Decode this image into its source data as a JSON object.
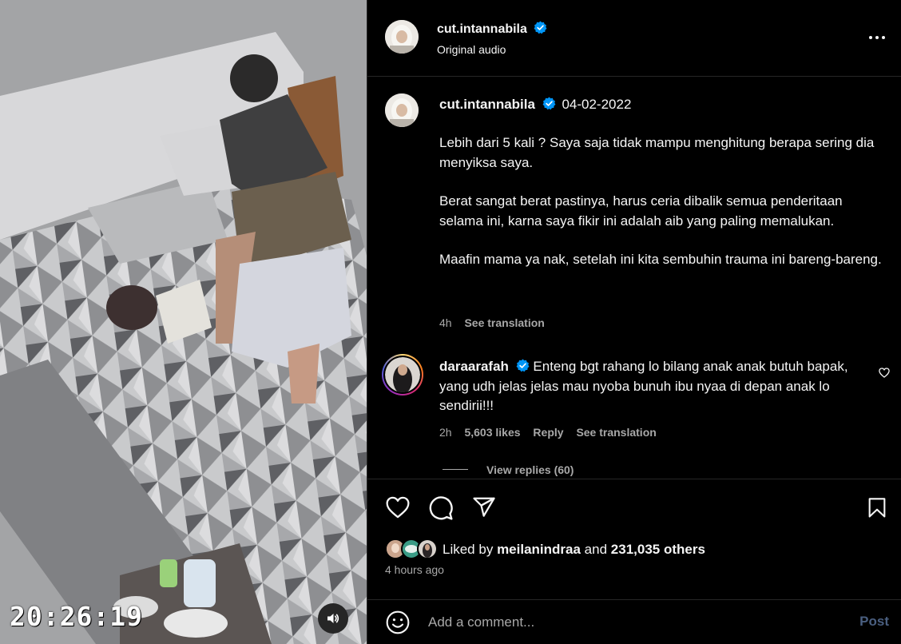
{
  "media": {
    "timestamp": "20:26:19",
    "audio_icon": "speaker-icon"
  },
  "header": {
    "username": "cut.intannabila",
    "audio_label": "Original audio",
    "more_icon": "more-horizontal-icon"
  },
  "caption": {
    "username": "cut.intannabila",
    "date": "04-02-2022",
    "paragraphs": [
      "Lebih dari 5 kali ? Saya saja tidak mampu menghitung berapa sering dia menyiksa saya.",
      "Berat sangat berat pastinya, harus ceria dibalik semua penderitaan selama ini, karna saya fikir ini adalah aib yang paling memalukan.",
      "Maafin mama ya nak, setelah ini kita sembuhin trauma ini bareng-bareng."
    ],
    "time": "4h",
    "see_translation": "See translation"
  },
  "comment": {
    "username": "daraarafah",
    "text": "Enteng bgt rahang lo bilang anak anak butuh bapak, yang udh jelas jelas mau nyoba bunuh ibu nyaa di depan anak lo sendirii!!!",
    "time": "2h",
    "likes": "5,603 likes",
    "reply": "Reply",
    "see_translation": "See translation",
    "view_replies": "View replies (60)"
  },
  "actions": {
    "liked_by_prefix": "Liked by",
    "liked_by_user": "meilanindraa",
    "and_word": "and",
    "others": "231,035 others",
    "time_ago": "4 hours ago"
  },
  "add_comment": {
    "placeholder": "Add a comment...",
    "post_label": "Post"
  },
  "colors": {
    "background": "#000000",
    "text": "#f5f5f5",
    "secondary_text": "#a8a8a8",
    "verified_blue": "#0095f6",
    "divider": "#262626",
    "post_disabled": "#4a5f80"
  }
}
